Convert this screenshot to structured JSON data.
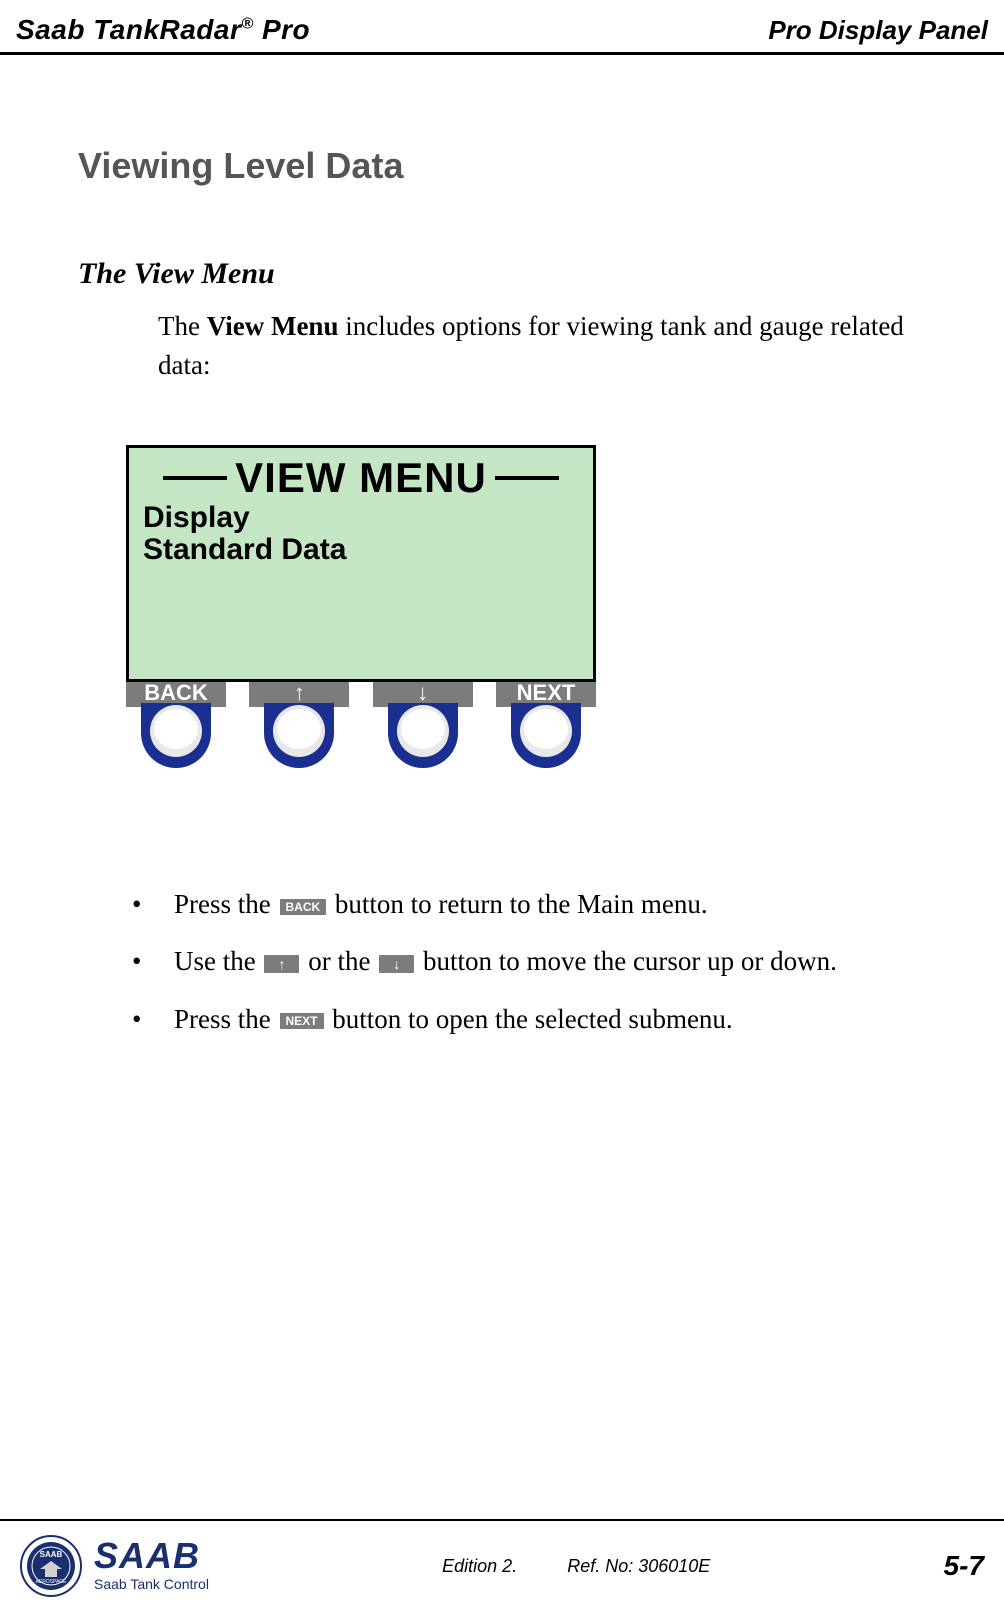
{
  "header": {
    "left_product_prefix": "Saab TankRadar",
    "left_product_reg": "®",
    "left_product_suffix": " Pro",
    "right": "Pro Display Panel"
  },
  "section_title": "Viewing Level Data",
  "subheading": "The View Menu",
  "paragraph_prefix": "The ",
  "paragraph_bold": "View Menu",
  "paragraph_suffix": " includes options for viewing tank and gauge related data:",
  "panel": {
    "title": "VIEW MENU",
    "line1": "Display",
    "line2": "Standard Data",
    "buttons": {
      "back": "BACK",
      "up": "↑",
      "down": "↓",
      "next": "NEXT"
    }
  },
  "bullets": {
    "b1_prefix": "Press the ",
    "b1_btn": "BACK",
    "b1_suffix": " button to return to the Main menu.",
    "b2_prefix": "Use the ",
    "b2_btn1": "↑",
    "b2_mid": " or the ",
    "b2_btn2": "↓",
    "b2_suffix": " button to move the cursor up or down.",
    "b3_prefix": "Press the ",
    "b3_btn": "NEXT",
    "b3_suffix": " button to open the selected submenu."
  },
  "footer": {
    "logo_text": "SAAB",
    "logo_sub": "Saab Tank Control",
    "edition": "Edition 2.",
    "ref": "Ref. No: 306010E",
    "page": "5-7"
  }
}
